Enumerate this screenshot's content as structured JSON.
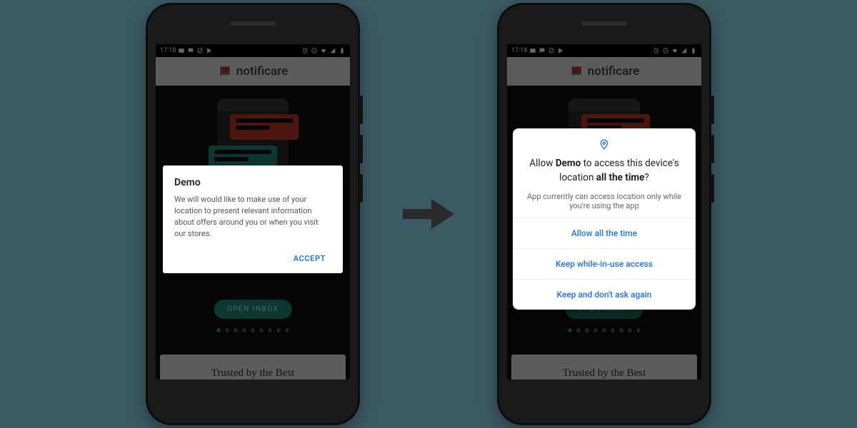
{
  "statusbar": {
    "time": "17:18"
  },
  "header": {
    "brand": "notificare"
  },
  "page": {
    "cta": "OPEN INBOX",
    "trusted": "Trusted by the Best",
    "dot_count": 9,
    "active_dot": 0
  },
  "dialog_left": {
    "title": "Demo",
    "body": "We will would like to make use of your location to present relevant information about offers around you or when you visit our stores.",
    "accept": "ACCEPT"
  },
  "dialog_right": {
    "prefix": "Allow ",
    "app_name": "Demo",
    "mid": " to access this device's location ",
    "scope": "all the time",
    "suffix": "?",
    "sub": "App currently can access location only while you're using the app",
    "opt1": "Allow all the time",
    "opt2": "Keep while-in-use access",
    "opt3": "Keep and don't ask again"
  }
}
